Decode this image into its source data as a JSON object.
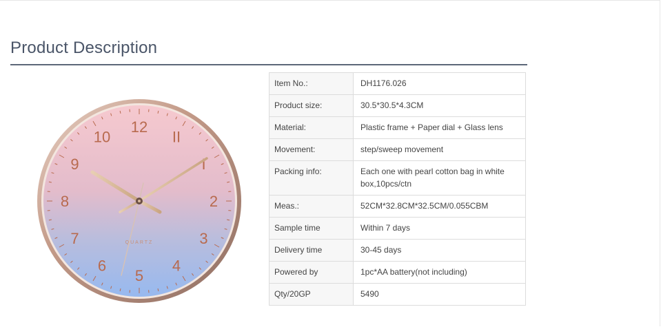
{
  "section": {
    "title": "Product Description"
  },
  "product_image": {
    "alt": "Wall clock",
    "dial_text": "QUARTZ",
    "numerals": [
      "12",
      "II",
      "I",
      "2",
      "3",
      "4",
      "5",
      "6",
      "7",
      "8",
      "9",
      "10"
    ],
    "colors": {
      "dial_top": "#f4c8d0",
      "dial_bottom": "#9dbcee",
      "frame": "#c9a08f",
      "numeral": "#b86a4e",
      "hands": "#d9b99a"
    }
  },
  "specs": {
    "rows": [
      {
        "label": "Item No.:",
        "value": "DH1176.026"
      },
      {
        "label": "Product size:",
        "value": "30.5*30.5*4.3CM"
      },
      {
        "label": "Material:",
        "value": "Plastic frame + Paper dial + Glass lens"
      },
      {
        "label": "Movement:",
        "value": "step/sweep movement"
      },
      {
        "label": "Packing info:",
        "value": "Each one with pearl cotton bag in white box,10pcs/ctn"
      },
      {
        "label": "Meas.:",
        "value": "52CM*32.8CM*32.5CM/0.055CBM"
      },
      {
        "label": "Sample time",
        "value": "Within 7 days"
      },
      {
        "label": "Delivery time",
        "value": "30-45 days"
      },
      {
        "label": "Powered by",
        "value": "1pc*AA battery(not including)"
      },
      {
        "label": "Qty/20GP",
        "value": "5490"
      }
    ]
  }
}
